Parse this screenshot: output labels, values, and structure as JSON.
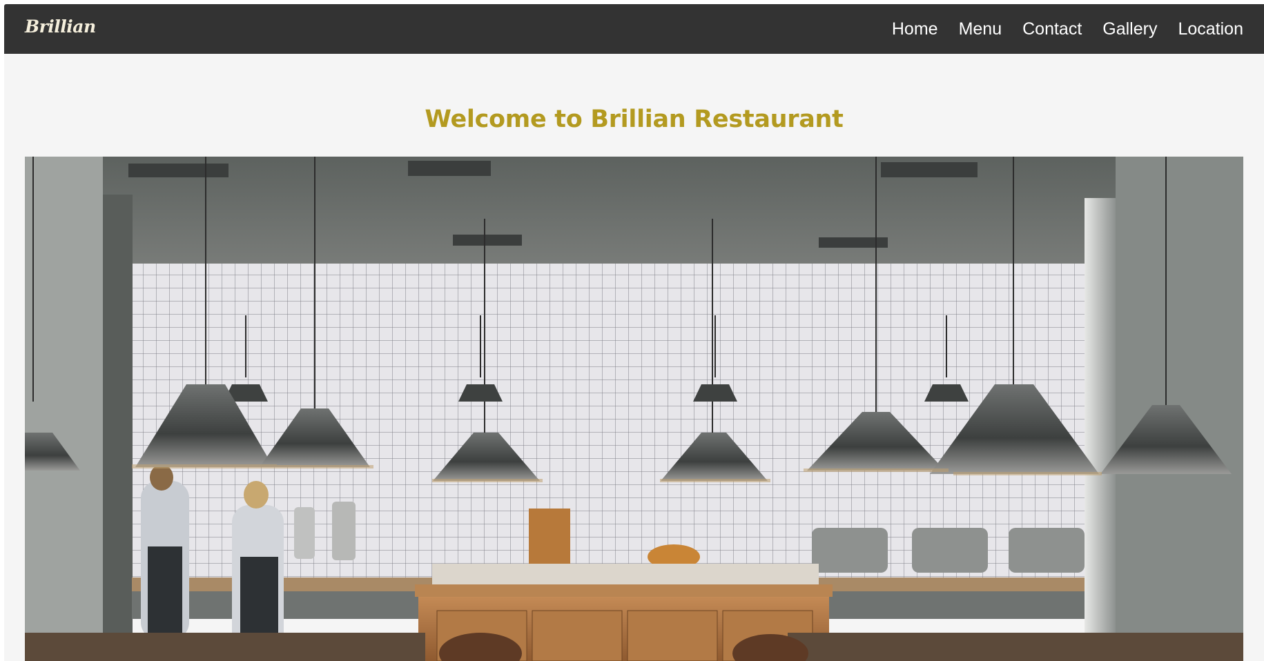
{
  "navbar": {
    "brand": "Brillian",
    "links": [
      "Home",
      "Menu",
      "Contact",
      "Gallery",
      "Location"
    ]
  },
  "main": {
    "heading": "Welcome to Brillian Restaurant",
    "hero_image": {
      "icon": "restaurant-interior-photo"
    }
  },
  "colors": {
    "navbar_bg": "#333333",
    "page_bg": "#f5f5f5",
    "heading": "#b39a20",
    "nav_text": "#ffffff"
  }
}
